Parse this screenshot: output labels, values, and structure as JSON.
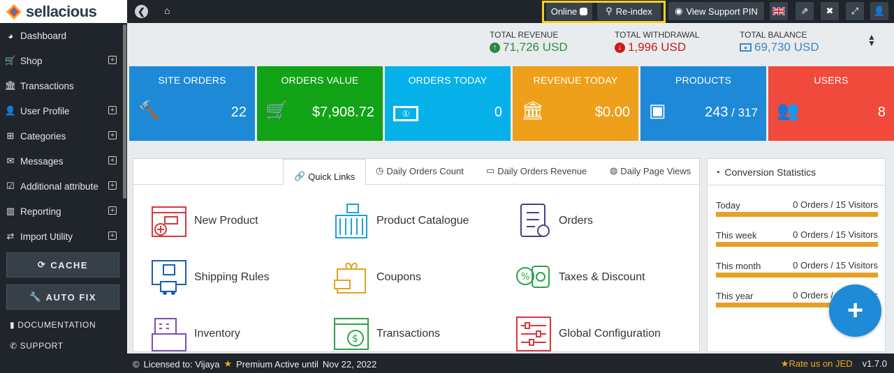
{
  "logo": "sellacious",
  "sidebar": {
    "items": [
      {
        "label": "Dashboard",
        "icon": "dashboard-icon"
      },
      {
        "label": "Shop",
        "icon": "cart-icon",
        "expand": "⊞"
      },
      {
        "label": "Transactions",
        "icon": "bank-icon"
      },
      {
        "label": "User Profile",
        "icon": "user-icon",
        "expand": "⊞"
      },
      {
        "label": "Categories",
        "icon": "sitemap-icon",
        "expand": "⊞"
      },
      {
        "label": "Messages",
        "icon": "envelope-icon",
        "expand": "⊞"
      },
      {
        "label": "Additional attribute",
        "icon": "check-square-icon",
        "expand": "⊞"
      },
      {
        "label": "Reporting",
        "icon": "bar-chart-icon",
        "expand": "⊞"
      },
      {
        "label": "Import Utility",
        "icon": "exchange-icon",
        "expand": "⊞"
      }
    ],
    "cache": "CACHE",
    "autofix": "AUTO FIX",
    "docs": "DOCUMENTATION",
    "support": "SUPPORT"
  },
  "topbar": {
    "online": "Online",
    "reindex": "Re-index",
    "support_pin": "View Support PIN"
  },
  "stats": {
    "revenue_label": "TOTAL REVENUE",
    "revenue": "71,726 USD",
    "withdrawal_label": "TOTAL WITHDRAWAL",
    "withdrawal": "1,996 USD",
    "balance_label": "TOTAL BALANCE",
    "balance": "69,730 USD"
  },
  "tiles": [
    {
      "title": "SITE ORDERS",
      "value": "22",
      "color": "#1e8ad7",
      "icon": "gavel-icon"
    },
    {
      "title": "ORDERS VALUE",
      "value": "$7,908.72",
      "color": "#11a315",
      "icon": "cart-plus-icon"
    },
    {
      "title": "ORDERS TODAY",
      "value": "0",
      "color": "#06b1ea",
      "icon": "money-icon"
    },
    {
      "title": "REVENUE TODAY",
      "value": "$0.00",
      "color": "#eea01a",
      "icon": "bank-icon"
    },
    {
      "title": "PRODUCTS",
      "value": "243",
      "value_sub": " / 317",
      "color": "#1e8ad7",
      "icon": "cubes-icon"
    },
    {
      "title": "USERS",
      "value": "8",
      "color": "#f04a3c",
      "icon": "users-icon"
    }
  ],
  "tabs": [
    "Quick Links",
    "Daily Orders Count",
    "Daily Orders Revenue",
    "Daily Page Views"
  ],
  "quicklinks": [
    "New Product",
    "Product Catalogue",
    "Orders",
    "Shipping Rules",
    "Coupons",
    "Taxes & Discount",
    "Inventory",
    "Transactions",
    "Global Configuration"
  ],
  "conversion": {
    "title": "Conversion Statistics",
    "rows": [
      {
        "label": "Today",
        "value": "0 Orders / 15 Visitors"
      },
      {
        "label": "This week",
        "value": "0 Orders / 15 Visitors"
      },
      {
        "label": "This month",
        "value": "0 Orders / 15 Visitors"
      },
      {
        "label": "This year",
        "value": "0 Orders / 15 Visitors"
      }
    ]
  },
  "footer": {
    "licensed": "Licensed to: Vijaya",
    "premium": "Premium Active until",
    "date": "Nov 22, 2022",
    "rate": "Rate us on JED",
    "version": "v1.7.0"
  },
  "fab": "+"
}
